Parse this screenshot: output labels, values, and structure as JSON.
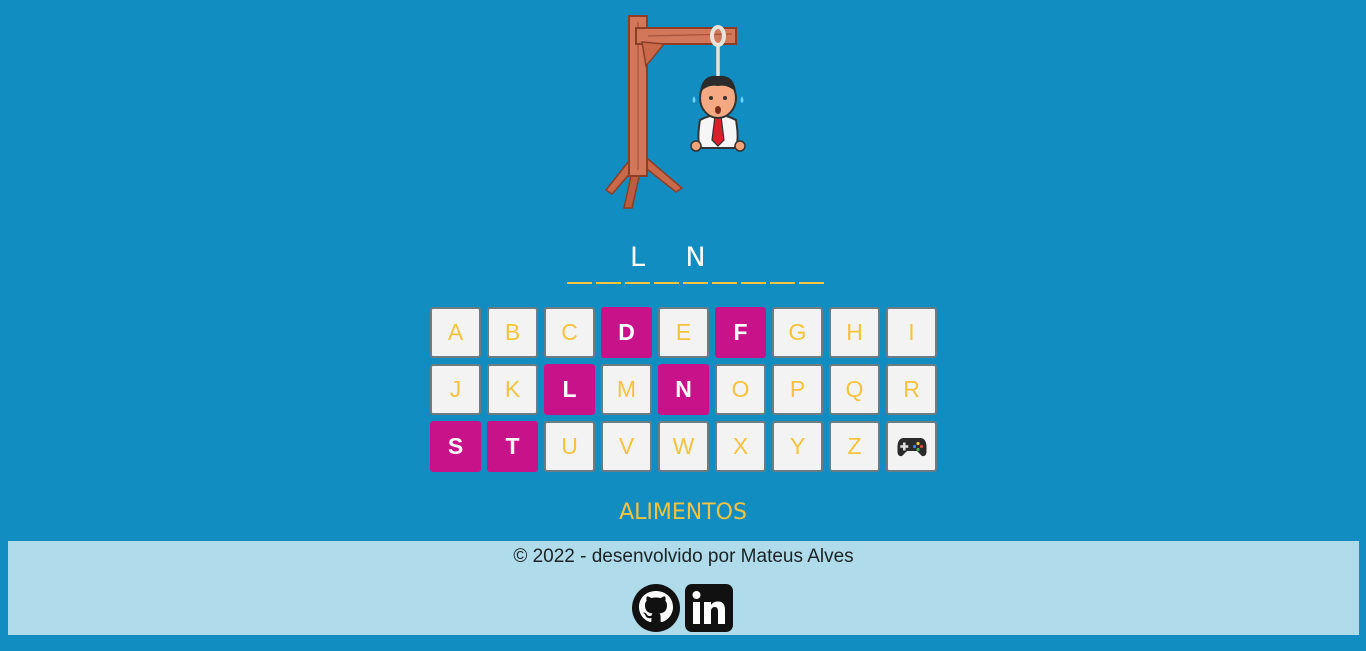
{
  "word": {
    "slots": [
      "",
      "",
      "L",
      "",
      "N",
      "",
      "",
      "",
      ""
    ]
  },
  "keyboard": {
    "keys": [
      {
        "letter": "A",
        "used": false
      },
      {
        "letter": "B",
        "used": false
      },
      {
        "letter": "C",
        "used": false
      },
      {
        "letter": "D",
        "used": true
      },
      {
        "letter": "E",
        "used": false
      },
      {
        "letter": "F",
        "used": true
      },
      {
        "letter": "G",
        "used": false
      },
      {
        "letter": "H",
        "used": false
      },
      {
        "letter": "I",
        "used": false
      },
      {
        "letter": "J",
        "used": false
      },
      {
        "letter": "K",
        "used": false
      },
      {
        "letter": "L",
        "used": true
      },
      {
        "letter": "M",
        "used": false
      },
      {
        "letter": "N",
        "used": true
      },
      {
        "letter": "O",
        "used": false
      },
      {
        "letter": "P",
        "used": false
      },
      {
        "letter": "Q",
        "used": false
      },
      {
        "letter": "R",
        "used": false
      },
      {
        "letter": "S",
        "used": true
      },
      {
        "letter": "T",
        "used": true
      },
      {
        "letter": "U",
        "used": false
      },
      {
        "letter": "V",
        "used": false
      },
      {
        "letter": "W",
        "used": false
      },
      {
        "letter": "X",
        "used": false
      },
      {
        "letter": "Y",
        "used": false
      },
      {
        "letter": "Z",
        "used": false
      }
    ],
    "new_game_icon": "gamepad-icon"
  },
  "category": "ALIMENTOS",
  "footer": {
    "credits": "© 2022 - desenvolvido por Mateus Alves",
    "links": [
      {
        "icon": "github-icon"
      },
      {
        "icon": "linkedin-icon"
      }
    ]
  },
  "colors": {
    "background": "#118dc1",
    "accent": "#f6c33f",
    "used_key": "#c8128a",
    "footer_bg": "#afdbea"
  }
}
